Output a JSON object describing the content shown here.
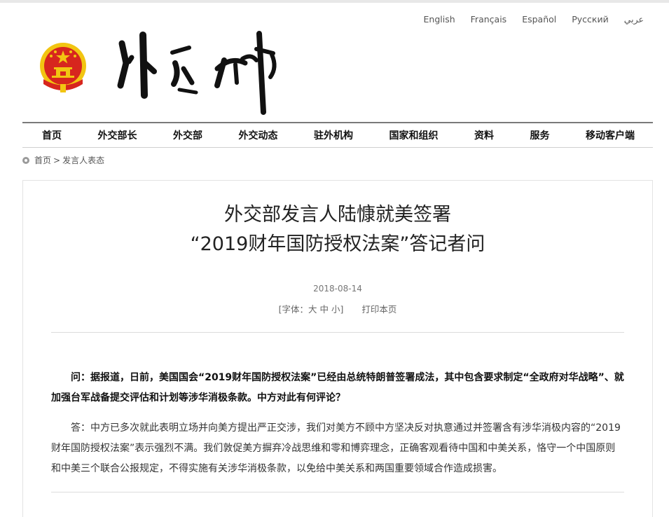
{
  "languages": [
    "English",
    "Français",
    "Español",
    "Русский",
    "عربي"
  ],
  "logo": {
    "calligraphy_text": "外交部"
  },
  "nav": [
    "首页",
    "外交部长",
    "外交部",
    "外交动态",
    "驻外机构",
    "国家和组织",
    "资料",
    "服务",
    "移动客户端"
  ],
  "breadcrumb": {
    "home": "首页",
    "separator": ">",
    "current": "发言人表态"
  },
  "article": {
    "title_line1": "外交部发言人陆慷就美签署",
    "title_line2": "“2019财年国防授权法案”答记者问",
    "date": "2018-08-14",
    "font_prefix": "[字体：",
    "font_large": "大",
    "font_medium": "中",
    "font_small": "小",
    "font_suffix": "]",
    "print": "打印本页",
    "question": "问：据报道，日前，美国国会“2019财年国防授权法案”已经由总统特朗普签署成法，其中包含要求制定“全政府对华战略”、就加强台军战备提交评估和计划等涉华消极条款。中方对此有何评论？",
    "answer": "答：中方已多次就此表明立场并向美方提出严正交涉，我们对美方不顾中方坚决反对执意通过并签署含有涉华消极内容的“2019财年国防授权法案”表示强烈不满。我们敦促美方摒弃冷战思维和零和博弈理念，正确客观看待中国和中美关系，恪守一个中国原则和中美三个联合公报规定，不得实施有关涉华消极条款，以免给中美关系和两国重要领域合作造成损害。"
  },
  "colors": {
    "emblem_red": "#d7261e",
    "emblem_gold": "#f2c511",
    "nav_rule": "#7a7a7a"
  }
}
